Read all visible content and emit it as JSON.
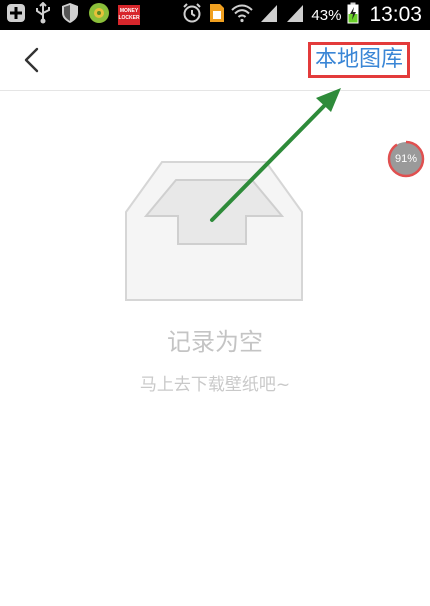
{
  "status_bar": {
    "battery_percent": "43%",
    "time": "13:03",
    "money_locker_line1": "MONEY",
    "money_locker_line2": "LOCKER",
    "icons": [
      "plus-icon",
      "usb-icon",
      "shield-icon",
      "puzzle-icon",
      "money-locker-icon",
      "alarm-icon",
      "sim-icon",
      "wifi-icon",
      "signal-icon",
      "signal-icon",
      "battery-charging-icon"
    ]
  },
  "header": {
    "title": "",
    "local_gallery_label": "本地图库",
    "back_icon": "chevron-left-icon"
  },
  "empty_state": {
    "title": "记录为空",
    "subtitle": "马上去下载壁纸吧~",
    "icon": "empty-inbox-icon"
  },
  "badge": {
    "percent": 0.91,
    "label": "91%"
  },
  "colors": {
    "accent": "#3a86d6",
    "highlight_border": "#e33b3b",
    "arrow": "#2e8b3a",
    "badge_ring": "#e05050",
    "badge_fill": "#9a9a9a"
  }
}
